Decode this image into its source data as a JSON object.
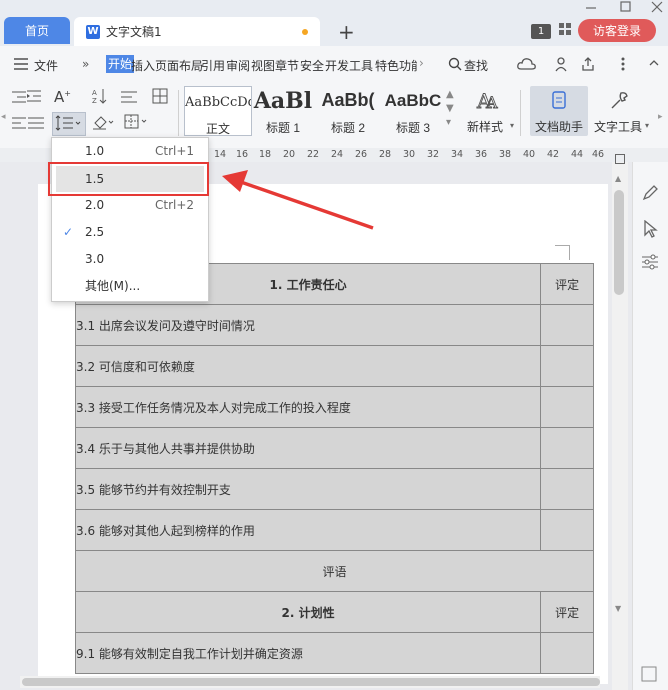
{
  "titlebar": {
    "home_tab": "首页",
    "doc_tab": "文字文稿1",
    "doc_icon": "W",
    "badge": "1",
    "login": "访客登录",
    "plus": "+"
  },
  "menubar": {
    "file": "文件",
    "tabs": [
      "开始",
      "插入",
      "页面布局",
      "引用",
      "审阅",
      "视图",
      "章节",
      "安全",
      "开发工具",
      "特色功能"
    ],
    "search": "查找"
  },
  "ribbon": {
    "styles": [
      {
        "sample": "AaBbCcDd",
        "label": "正文"
      },
      {
        "sample": "AaBl",
        "label": "标题 1"
      },
      {
        "sample": "AaBb(",
        "label": "标题 2"
      },
      {
        "sample": "AaBbC",
        "label": "标题 3"
      }
    ],
    "new_style": "新样式",
    "doc_assistant": "文档助手",
    "text_tools": "文字工具"
  },
  "ruler": {
    "ticks": [
      "14",
      "16",
      "18",
      "20",
      "22",
      "24",
      "26",
      "28",
      "30",
      "32",
      "34",
      "36",
      "38",
      "40",
      "42",
      "44",
      "46"
    ]
  },
  "line_spacing_menu": {
    "items": [
      {
        "value": "1.0",
        "shortcut": "Ctrl+1",
        "checked": false
      },
      {
        "value": "1.5",
        "shortcut": "",
        "checked": false,
        "highlighted": true
      },
      {
        "value": "2.0",
        "shortcut": "Ctrl+2",
        "checked": false
      },
      {
        "value": "2.5",
        "shortcut": "",
        "checked": true
      },
      {
        "value": "3.0",
        "shortcut": "",
        "checked": false
      },
      {
        "value": "其他(M)...",
        "shortcut": "",
        "checked": false
      }
    ]
  },
  "table": {
    "section1_title": "1. 工作责任心",
    "rating_header": "评定",
    "rows": [
      "3.1 出席会议发问及遵守时间情况",
      "3.2 可信度和可依赖度",
      "3.3 接受工作任务情况及本人对完成工作的投入程度",
      "3.4 乐于与其他人共事并提供协助",
      "3.5 能够节约并有效控制开支",
      "3.6 能够对其他人起到榜样的作用"
    ],
    "comment": "评语",
    "section2_title": "2. 计划性",
    "rating_header2": "评定",
    "row2": "9.1 能够有效制定自我工作计划并确定资源"
  },
  "colors": {
    "accent": "#4e87e6",
    "highlight_red": "#e53935",
    "login_red": "#e05a5a"
  }
}
